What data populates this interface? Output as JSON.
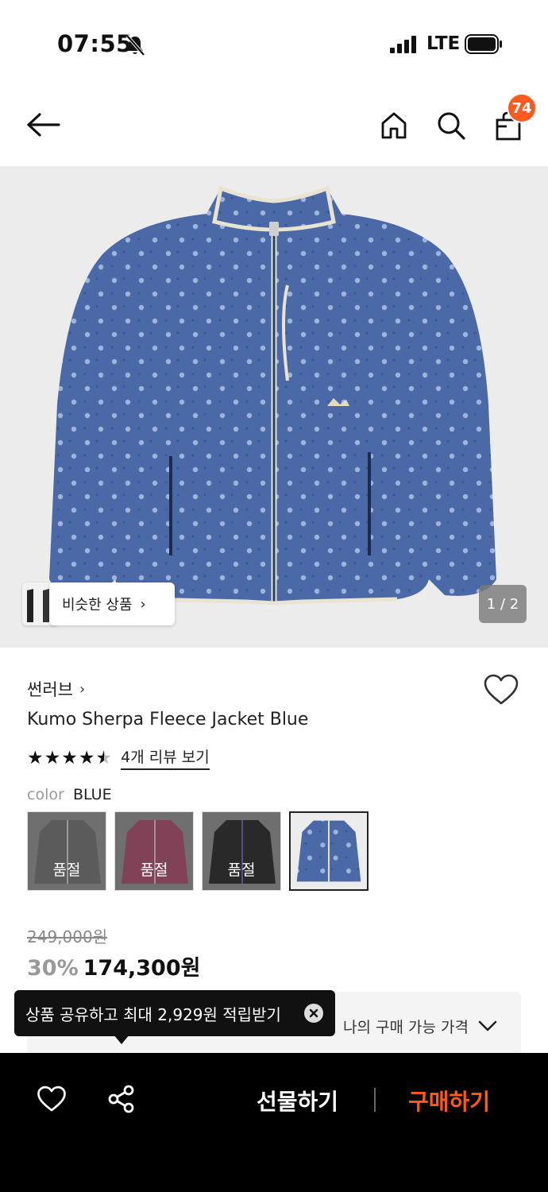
{
  "status_bar": {
    "time": "07:55",
    "network": "LTE"
  },
  "nav": {
    "cart_count": "74"
  },
  "gallery": {
    "similar_label": "비슷한 상품",
    "page_counter": "1 / 2"
  },
  "product": {
    "brand": "썬러브",
    "name": "Kumo Sherpa Fleece Jacket Blue",
    "rating": 4.5,
    "review_link": "4개 리뷰 보기",
    "color_label": "color",
    "color_value": "BLUE",
    "swatches": [
      {
        "color": "#8a8a8a",
        "soldout": "품절"
      },
      {
        "color": "#b35a78",
        "soldout": "품절"
      },
      {
        "color": "#3a3a3a",
        "soldout": "품절"
      },
      {
        "color": "#4a69a6",
        "soldout": ""
      }
    ],
    "original_price": "249,000원",
    "discount": "30%",
    "sale_price": "174,300원"
  },
  "my_price": {
    "label": "나의 구매 가능 가격"
  },
  "tooltip": {
    "text": "상품 공유하고 최대 2,929원 적립받기"
  },
  "bottom_bar": {
    "gift_label": "선물하기",
    "buy_label": "구매하기"
  },
  "colors": {
    "accent": "#ff5a1f",
    "jacket_blue": "#4a69a6"
  }
}
